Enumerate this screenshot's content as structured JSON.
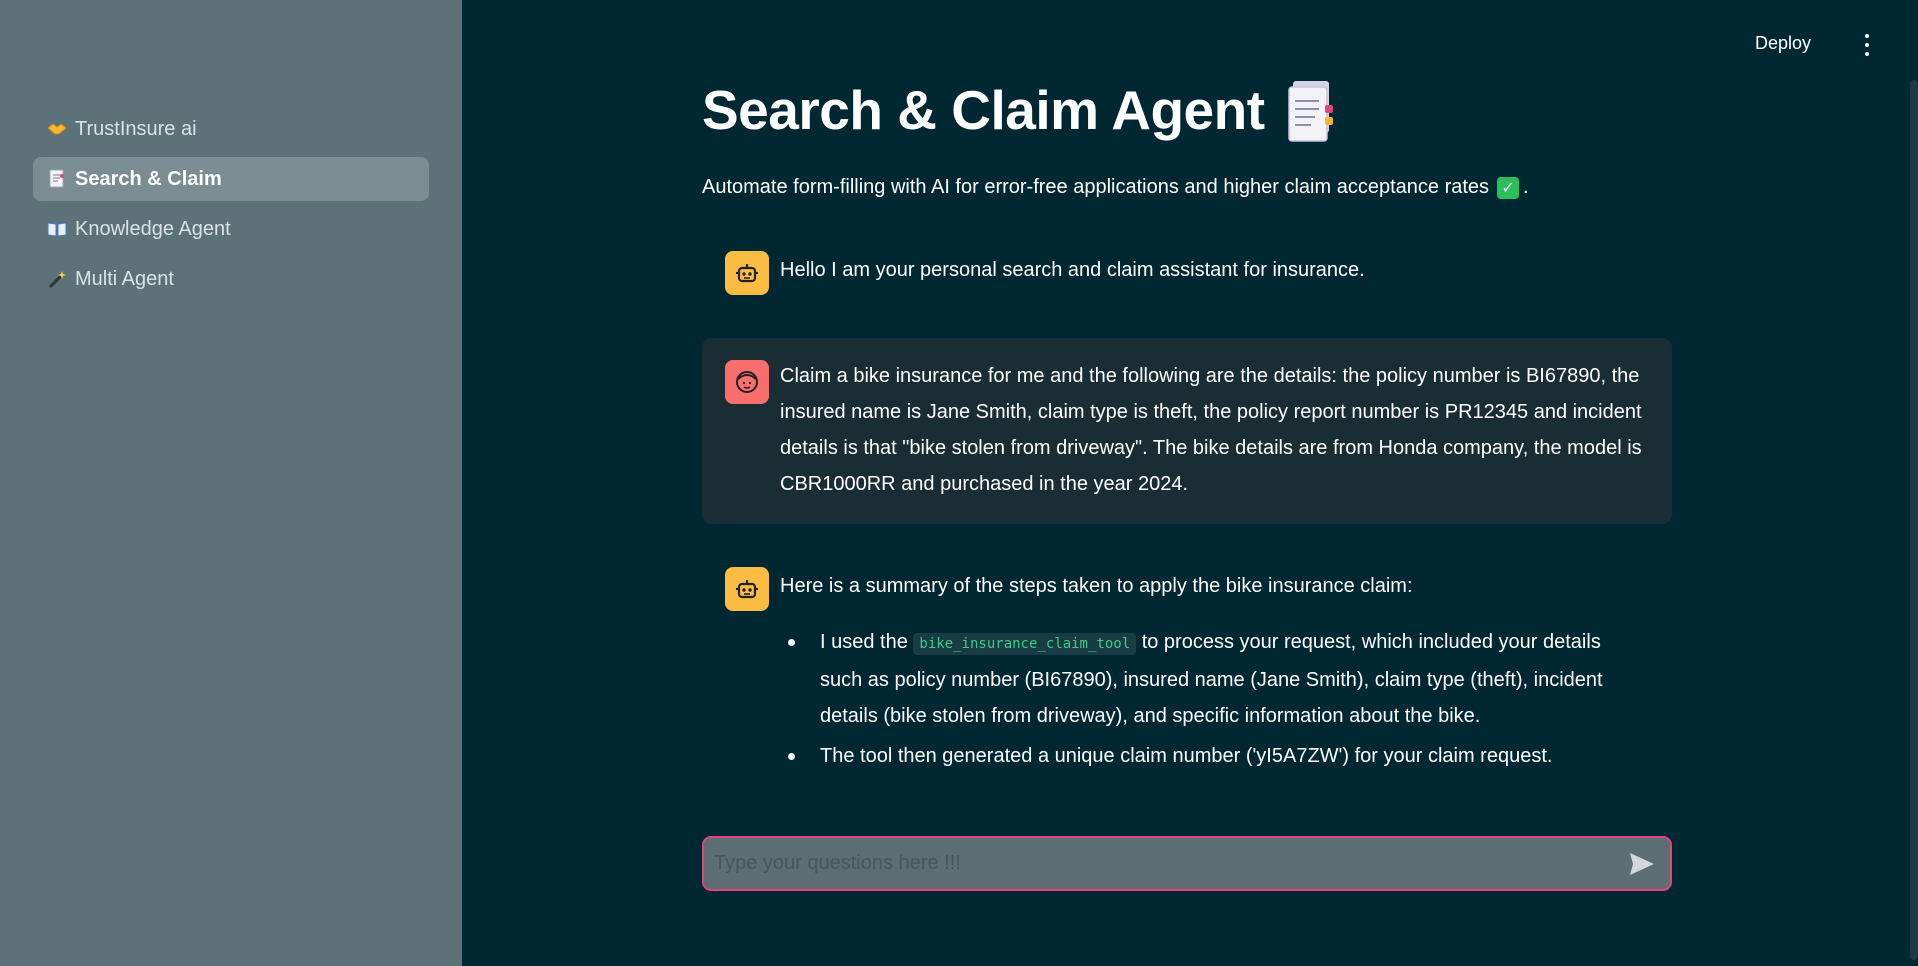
{
  "sidebar": {
    "items": [
      {
        "icon": "handshake-icon",
        "label": "TrustInsure ai",
        "active": false
      },
      {
        "icon": "document-icon",
        "label": "Search & Claim",
        "active": true
      },
      {
        "icon": "book-icon",
        "label": "Knowledge Agent",
        "active": false
      },
      {
        "icon": "magic-wand-icon",
        "label": "Multi Agent",
        "active": false
      }
    ]
  },
  "header": {
    "deploy_label": "Deploy"
  },
  "main": {
    "title": "Search & Claim Agent",
    "subtitle": "Automate form-filling with AI for error-free applications and higher claim acceptance rates",
    "subtitle_suffix": "."
  },
  "chat": {
    "messages": [
      {
        "role": "assistant",
        "text": "Hello I am your personal search and claim assistant for insurance."
      },
      {
        "role": "user",
        "text": "Claim a bike insurance for me and the following are the details: the policy number is BI67890, the insured name is Jane Smith, claim type is theft, the policy report number is PR12345 and incident details is that \"bike stolen from driveway\". The bike details are from Honda company, the model is CBR1000RR and purchased in the year 2024."
      },
      {
        "role": "assistant",
        "intro": "Here is a summary of the steps taken to apply the bike insurance claim:",
        "bullet1_prefix": "I used the",
        "bullet1_code": "bike_insurance_claim_tool",
        "bullet1_suffix": "to process your request, which included your details such as policy number (BI67890), insured name (Jane Smith), claim type (theft), incident details (bike stolen from driveway), and specific information about the bike.",
        "bullet2": "The tool then generated a unique claim number ('yI5A7ZW') for your claim request."
      }
    ]
  },
  "input": {
    "placeholder": "Type your questions here !!!"
  },
  "colors": {
    "background": "#002833",
    "sidebar": "#5c7178",
    "accent": "#e0457b",
    "bot_avatar": "#fbbd41",
    "user_avatar": "#fb6e6e"
  }
}
